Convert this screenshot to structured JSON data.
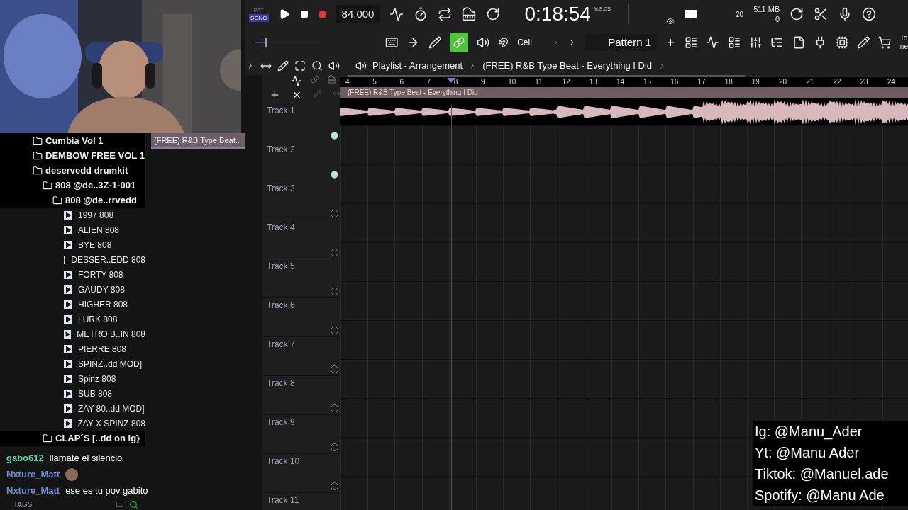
{
  "transport": {
    "pat_label": "PAT",
    "song_label": "SONG",
    "song_mode": true,
    "recording": true,
    "tempo": "84.000",
    "time": "0:18:54",
    "time_format": "M:S:CS",
    "cpu": "20",
    "memory": "511 MB",
    "polyphony": "0"
  },
  "toolbar": {
    "master_pitch": {
      "level": 0.15
    },
    "snap": "Cell",
    "pattern": "Pattern 1",
    "link_on": true,
    "cut_texts": [
      "To",
      "ne"
    ]
  },
  "breadcrumb": [
    "Playlist - Arrangement",
    "(FREE) R&B Type Beat - Everything I Did"
  ],
  "browser": {
    "dragged_clip": "(FREE) R&B Type Beat..",
    "footer": "TAGS",
    "items": [
      {
        "kind": "folder",
        "label": "Cumbia Vol 1"
      },
      {
        "kind": "folder",
        "label": "DEMBOW FREE VOL 1"
      },
      {
        "kind": "folder",
        "label": "deservedd drumkit",
        "children": [
          {
            "kind": "folder",
            "label": "808 @de..3Z-1-001",
            "children": [
              {
                "kind": "folder",
                "label": "808 @de..rrvedd",
                "children": [
                  {
                    "kind": "file",
                    "label": "1997 808"
                  },
                  {
                    "kind": "file",
                    "label": "ALIEN 808"
                  },
                  {
                    "kind": "file",
                    "label": "BYE 808"
                  },
                  {
                    "kind": "file",
                    "label": "DESSER..EDD 808"
                  },
                  {
                    "kind": "file",
                    "label": "FORTY 808"
                  },
                  {
                    "kind": "file",
                    "label": "GAUDY 808"
                  },
                  {
                    "kind": "file",
                    "label": "HIGHER 808"
                  },
                  {
                    "kind": "file",
                    "label": "LURK 808"
                  },
                  {
                    "kind": "file",
                    "label": "METRO B..IN 808"
                  },
                  {
                    "kind": "file",
                    "label": "PIERRE 808"
                  },
                  {
                    "kind": "file",
                    "label": "SPINZ..dd MOD]"
                  },
                  {
                    "kind": "file",
                    "label": "Spinz 808"
                  },
                  {
                    "kind": "file",
                    "label": "SUB 808"
                  },
                  {
                    "kind": "file",
                    "label": "ZAY 80..dd MOD]"
                  },
                  {
                    "kind": "file",
                    "label": "ZAY X SPINZ 808"
                  }
                ]
              }
            ]
          },
          {
            "kind": "folder",
            "label": "CLAP´S [..dd on ig}"
          }
        ]
      }
    ]
  },
  "chat": [
    {
      "kind": "text",
      "user": "gabo612",
      "color": "#5fd3a6",
      "message": "llamate el silencio"
    },
    {
      "kind": "emote",
      "user": "Nxture_Matt",
      "color": "#6b8fd6"
    },
    {
      "kind": "text",
      "user": "Nxture_Matt",
      "color": "#6b8fd6",
      "message": "ese es tu pov gabito"
    }
  ],
  "playlist": {
    "ruler": [
      "4",
      "5",
      "6",
      "7",
      "8",
      "9",
      "10",
      "11",
      "12",
      "13",
      "14",
      "15",
      "16",
      "17",
      "18",
      "19",
      "20",
      "21",
      "22",
      "23",
      "24"
    ],
    "tracks": [
      {
        "name": "Track 1",
        "enabled": true,
        "clip": {
          "title": "(FREE) R&B Type Beat - Everything I Did"
        }
      },
      {
        "name": "Track 2",
        "enabled": true
      },
      {
        "name": "Track 3",
        "enabled": false
      },
      {
        "name": "Track 4",
        "enabled": false
      },
      {
        "name": "Track 5",
        "enabled": false
      },
      {
        "name": "Track 6",
        "enabled": false
      },
      {
        "name": "Track 7",
        "enabled": false
      },
      {
        "name": "Track 8",
        "enabled": false
      },
      {
        "name": "Track 9",
        "enabled": false
      },
      {
        "name": "Track 10",
        "enabled": false
      },
      {
        "name": "Track 11"
      }
    ]
  },
  "overlay": [
    "Ig: @Manu_Ader",
    "Yt: @Manu Ader",
    "Tiktok: @Manuel.ade",
    "Spotify: @Manu Ade"
  ]
}
